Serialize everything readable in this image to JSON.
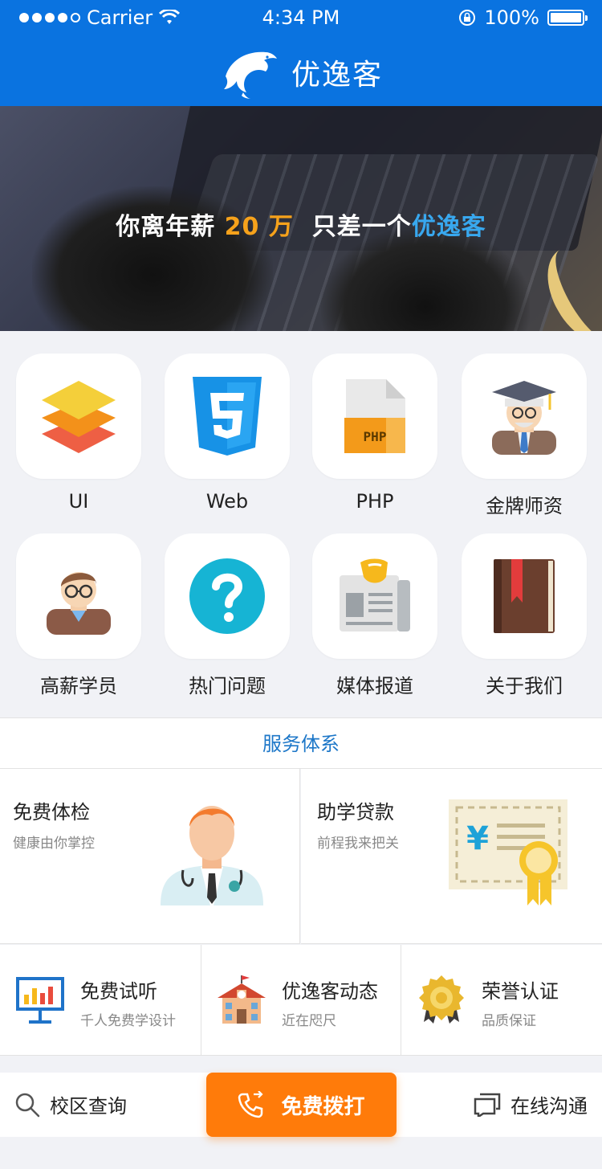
{
  "status_bar": {
    "carrier": "Carrier",
    "time": "4:34 PM",
    "battery": "100%"
  },
  "nav": {
    "title": "优逸客"
  },
  "banner": {
    "slogan_part1": "你离年薪 ",
    "slogan_salary": "20 万",
    "slogan_part2": "  只差一个",
    "slogan_brand": "优逸客"
  },
  "grid": [
    {
      "label": "UI",
      "icon": "layers-icon"
    },
    {
      "label": "Web",
      "icon": "html5-icon"
    },
    {
      "label": "PHP",
      "icon": "php-file-icon"
    },
    {
      "label": "金牌师资",
      "icon": "professor-icon"
    },
    {
      "label": "高薪学员",
      "icon": "student-icon"
    },
    {
      "label": "热门问题",
      "icon": "question-icon"
    },
    {
      "label": "媒体报道",
      "icon": "newspaper-icon"
    },
    {
      "label": "关于我们",
      "icon": "book-icon"
    }
  ],
  "services": {
    "header": "服务体系",
    "big": [
      {
        "title": "免费体检",
        "subtitle": "健康由你掌控",
        "icon": "doctor-icon"
      },
      {
        "title": "助学贷款",
        "subtitle": "前程我来把关",
        "icon": "certificate-icon"
      }
    ],
    "small": [
      {
        "title": "免费试听",
        "subtitle": "千人免费学设计",
        "icon": "presentation-icon"
      },
      {
        "title": "优逸客动态",
        "subtitle": "近在咫尺",
        "icon": "school-icon"
      },
      {
        "title": "荣誉认证",
        "subtitle": "品质保证",
        "icon": "medal-icon"
      }
    ]
  },
  "bottom_bar": {
    "campus": "校区查询",
    "call": "免费拨打",
    "chat": "在线沟通"
  }
}
